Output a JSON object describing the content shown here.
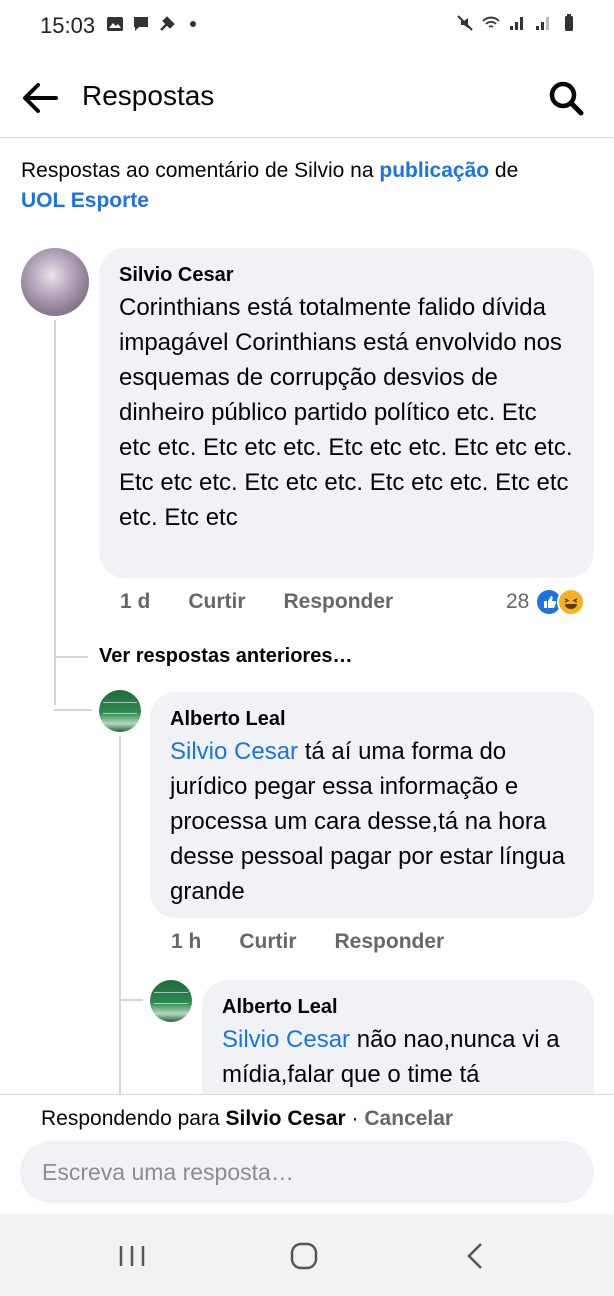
{
  "status_bar": {
    "time": "15:03"
  },
  "app_bar": {
    "title": "Respostas",
    "back_icon": "arrow-left-icon",
    "search_icon": "search-icon"
  },
  "context": {
    "prefix": "Respostas ao comentário de Silvio na ",
    "link_text": "publicação",
    "middle": " de",
    "page_name": "UOL Esporte"
  },
  "main_comment": {
    "author": "Silvio Cesar",
    "text": "Corinthians está totalmente falido dívida impagável Corinthians está envolvido nos esquemas de corrupção desvios de dinheiro público partido político etc. Etc etc etc. Etc etc etc. Etc etc etc. Etc etc etc. Etc etc etc. Etc etc etc. Etc etc etc. Etc etc etc. Etc etc",
    "time": "1 d",
    "like_label": "Curtir",
    "reply_label": "Responder",
    "reaction_count": "28"
  },
  "view_previous": "Ver respostas anteriores…",
  "replies": [
    {
      "author": "Alberto Leal",
      "mention": "Silvio Cesar",
      "text": " tá aí uma forma do jurídico pegar essa informação e processa um cara desse,tá na hora desse pessoal pagar por estar língua grande",
      "time": "1 h",
      "like_label": "Curtir",
      "reply_label": "Responder"
    },
    {
      "author": "Alberto Leal",
      "mention": "Silvio Cesar",
      "text": " não nao,nunca vi a mídia,falar que o time tá"
    }
  ],
  "composer": {
    "replying_prefix": "Respondendo para ",
    "replying_name": "Silvio Cesar",
    "separator": " · ",
    "cancel_label": "Cancelar",
    "placeholder": "Escreva uma resposta…"
  },
  "colors": {
    "accent": "#1b74e4",
    "bubble": "#f0f2f5",
    "muted": "#65676b"
  }
}
